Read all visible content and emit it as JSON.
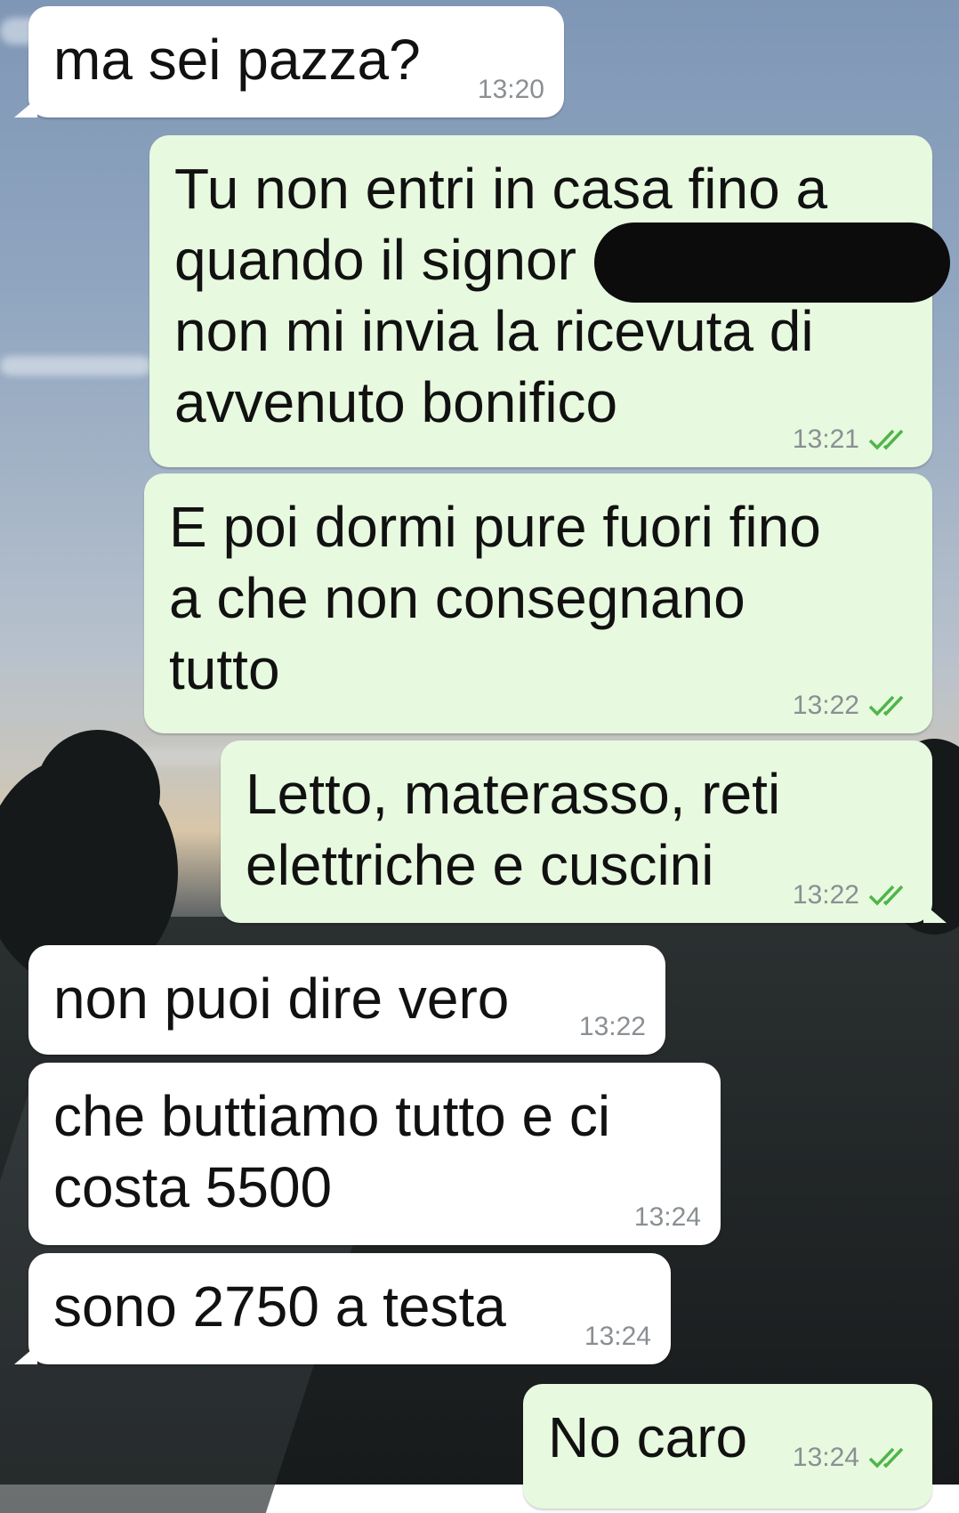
{
  "messages": [
    {
      "text": "ma sei pazza?",
      "time": "13:20",
      "direction": "incoming"
    },
    {
      "text": "Tu non entri in casa fino a\nquando il signor\nnon mi invia la ricevuta di\navvenuto bonifico",
      "time": "13:21",
      "direction": "outgoing",
      "redacted": true
    },
    {
      "text": "E poi dormi pure fuori fino\na che non consegnano\ntutto",
      "time": "13:22",
      "direction": "outgoing"
    },
    {
      "text": "Letto, materasso, reti\nelettriche e cuscini",
      "time": "13:22",
      "direction": "outgoing"
    },
    {
      "text": "non puoi dire vero",
      "time": "13:22",
      "direction": "incoming"
    },
    {
      "text": "che buttiamo tutto e ci\ncosta 5500",
      "time": "13:24",
      "direction": "incoming"
    },
    {
      "text": "sono 2750 a testa",
      "time": "13:24",
      "direction": "incoming"
    },
    {
      "text": "No caro",
      "time": "13:24",
      "direction": "outgoing"
    }
  ],
  "colors": {
    "incoming_bubble": "#ffffff",
    "outgoing_bubble": "#e7f9df",
    "read_check": "#4fb54a",
    "timestamp": "#8a8f93"
  },
  "icons": {
    "read_receipt": "double-check-icon"
  }
}
